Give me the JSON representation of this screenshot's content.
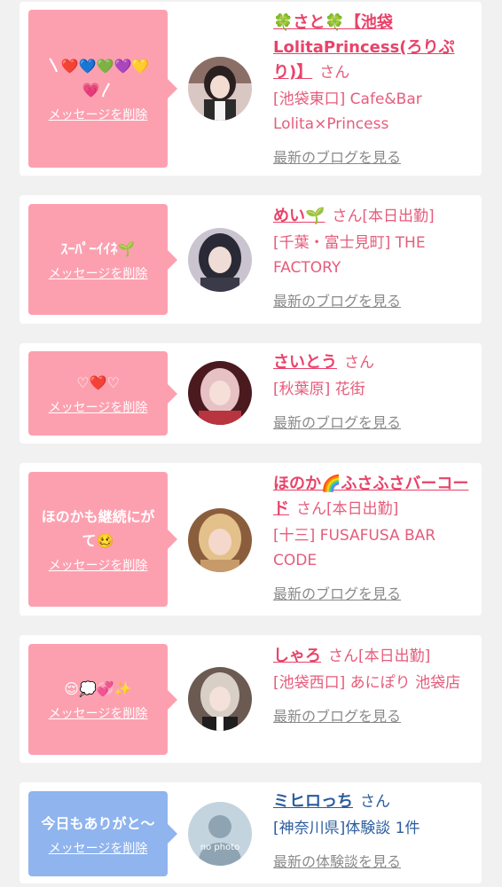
{
  "colors": {
    "card_bg": "#ffffff",
    "page_bg": "#f1f1f1",
    "bubble_pink": "#fca0b0",
    "bubble_blue": "#8fb4ee",
    "name_pink": "#e8436a",
    "name_blue": "#2b5c9e",
    "link_gray": "#8a8a8a"
  },
  "items": [
    {
      "message": "〵❤️💙💚💜💛💗〳",
      "delete_label": "メッセージを削除",
      "name": "🍀さと🍀【池袋LolitaPrincess(ろりぷり)】",
      "honorific": "さん",
      "status": "",
      "area": "[池袋東口] Cafe&Bar Lolita×Princess",
      "link": "最新のブログを見る",
      "avatar": "avatar-photo"
    },
    {
      "message": "ｽｰﾊﾟｰｲｲﾈ🌱",
      "delete_label": "メッセージを削除",
      "name": "めい🌱",
      "honorific": "さん",
      "status": "[本日出勤]",
      "area": "[千葉・富士見町] THE FACTORY",
      "link": "最新のブログを見る",
      "avatar": "avatar-photo"
    },
    {
      "message": "♡❤️♡",
      "delete_label": "メッセージを削除",
      "name": "さいとう",
      "honorific": "さん",
      "status": "",
      "area": "[秋葉原] 花街",
      "link": "最新のブログを見る",
      "avatar": "avatar-photo"
    },
    {
      "message": "ほのかも継続にがて🥴",
      "delete_label": "メッセージを削除",
      "name": "ほのか🌈ふさふさバーコード",
      "honorific": "さん",
      "status": "[本日出勤]",
      "area": "[十三] FUSAFUSA BAR CODE",
      "link": "最新のブログを見る",
      "avatar": "avatar-photo"
    },
    {
      "message": "😌💭💞✨",
      "delete_label": "メッセージを削除",
      "name": "しゃろ",
      "honorific": "さん",
      "status": "[本日出勤]",
      "area": "[池袋西口] あにぽり 池袋店",
      "link": "最新のブログを見る",
      "avatar": "avatar-photo"
    },
    {
      "message": "今日もありがと〜",
      "delete_label": "メッセージを削除",
      "name": "ミヒロっち",
      "honorific": "さん",
      "status": "",
      "area": "[神奈川県]体験談 1件",
      "link": "最新の体験談を見る",
      "avatar": "no-photo-avatar",
      "avatar_text": "no photo"
    }
  ]
}
